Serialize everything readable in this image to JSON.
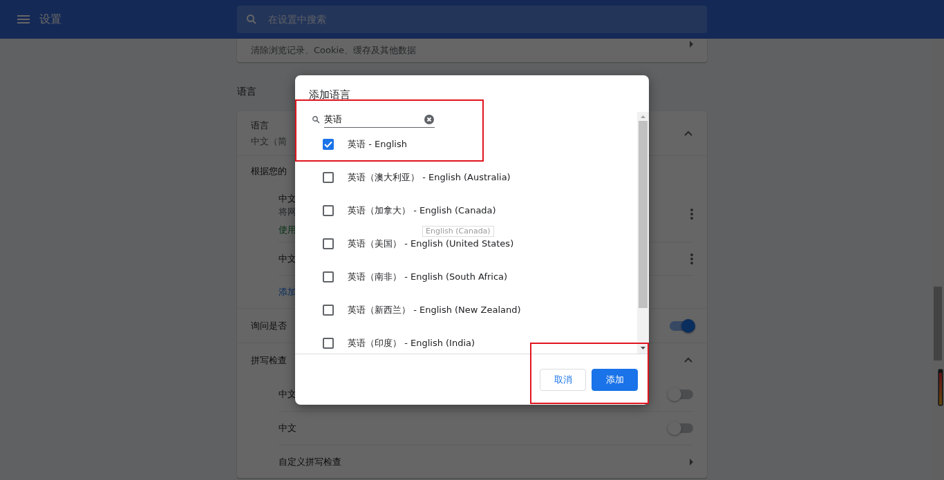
{
  "topbar": {
    "title": "设置",
    "search": {
      "placeholder": "在设置中搜索"
    }
  },
  "privacy_card": {
    "row": "清除浏览记录、Cookie、缓存及其他数据"
  },
  "language_section": {
    "heading": "语言",
    "languages": {
      "title": "语言",
      "subtitle": "中文（简",
      "expanded": true,
      "label": "根据您的",
      "items": [
        {
          "title": "中文",
          "desc": "将网",
          "status": "使用"
        },
        {
          "title": "中文"
        }
      ],
      "add_link": "添加"
    },
    "translate": {
      "text": "询问是否",
      "on": true
    },
    "spellcheck": {
      "title": "拼写检查",
      "expanded": true,
      "items": [
        {
          "text": "中文",
          "on": false
        },
        {
          "text": "中文",
          "on": false
        }
      ],
      "custom": "自定义拼写检查"
    }
  },
  "dialog": {
    "title": "添加语言",
    "search": {
      "value": "英语"
    },
    "options": [
      {
        "label": "英语 - English",
        "checked": true
      },
      {
        "label": "英语（澳大利亚） - English (Australia)",
        "checked": false
      },
      {
        "label": "英语（加拿大） - English (Canada)",
        "checked": false
      },
      {
        "label": "英语（美国） - English (United States)",
        "checked": false
      },
      {
        "label": "英语（南非） - English (South Africa)",
        "checked": false
      },
      {
        "label": "英语（新西兰） - English (New Zealand)",
        "checked": false
      },
      {
        "label": "英语（印度） - English (India)",
        "checked": false
      }
    ],
    "tooltip": "English (Canada)",
    "buttons": [
      {
        "label": "取消",
        "kind": "secondary"
      },
      {
        "label": "添加",
        "kind": "primary"
      }
    ]
  }
}
